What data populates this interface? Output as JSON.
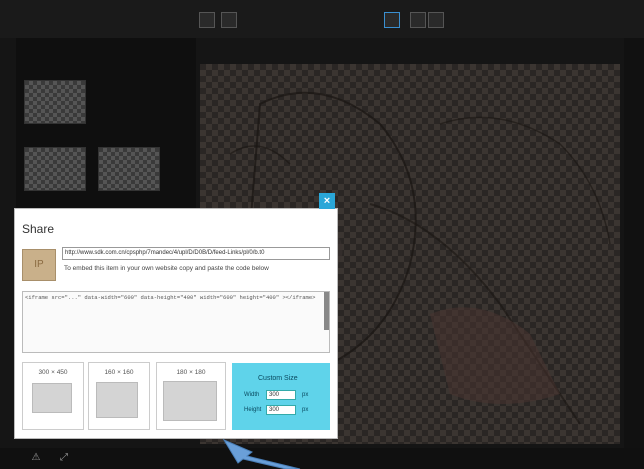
{
  "panel": {
    "title": "",
    "filter": ""
  },
  "canvas": {
    "title": ""
  },
  "right_bar": {
    "label": ""
  },
  "share_dialog": {
    "title": "Share",
    "close_label": "×",
    "thumb_label": "IP",
    "url": "http://www.sdk.com.cn/cpsphp/7mandec/4/upl/D/D0B/D/feed-Links/pl/0/b.t0",
    "help_text": "To embed this item in your own website copy and paste the code below",
    "embed_code": "<iframe src=\"...\" data-width=\"600\" data-height=\"400\" width=\"600\" height=\"400\" ></iframe>",
    "size_options": [
      {
        "label": "300 × 450"
      },
      {
        "label": "160 × 160"
      },
      {
        "label": "180 × 180"
      }
    ],
    "custom": {
      "title": "Custom Size",
      "width_label": "Width",
      "width_value": "300",
      "width_unit": "px",
      "height_label": "Height",
      "height_value": "300",
      "height_unit": "px"
    }
  },
  "colors": {
    "accent": "#2aa7d8",
    "custom_bg": "#5fd3ea",
    "arrow": "#6a9fd8"
  }
}
